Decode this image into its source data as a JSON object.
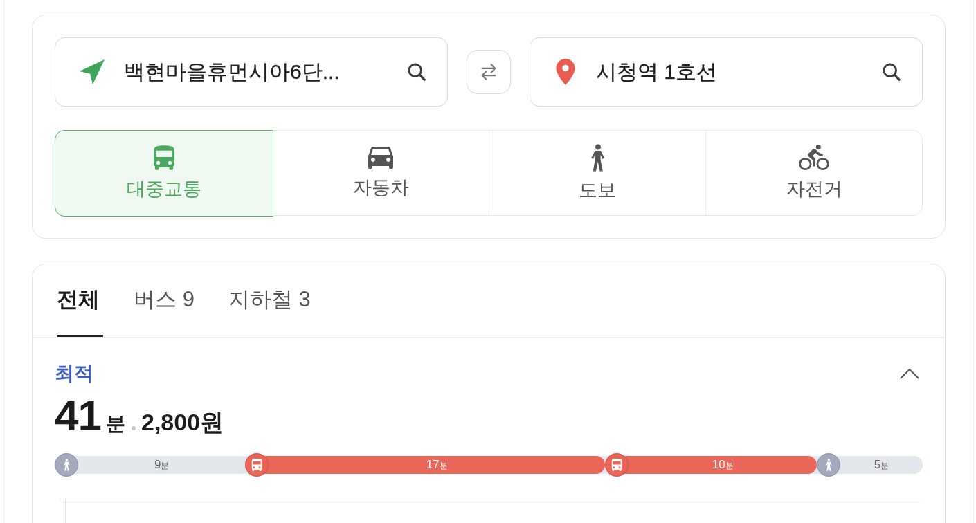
{
  "search": {
    "origin": {
      "value": "백현마을휴먼시아6단..."
    },
    "destination": {
      "value": "시청역 1호선"
    },
    "modes": [
      {
        "kind": "bus",
        "label": "대중교통",
        "selected": true
      },
      {
        "kind": "car",
        "label": "자동차",
        "selected": false
      },
      {
        "kind": "walk",
        "label": "도보",
        "selected": false
      },
      {
        "kind": "bike",
        "label": "자전거",
        "selected": false
      }
    ]
  },
  "results": {
    "tabs": [
      {
        "label": "전체",
        "selected": true
      },
      {
        "label": "버스",
        "count": "9",
        "selected": false
      },
      {
        "label": "지하철",
        "count": "3",
        "selected": false
      }
    ],
    "route": {
      "tag": "최적",
      "expanded": true,
      "duration": "41",
      "duration_unit": "분",
      "fare": "2,800원",
      "segments": [
        {
          "kind": "walk",
          "minutes": "9",
          "unit": "분"
        },
        {
          "kind": "bus",
          "minutes": "17",
          "unit": "분"
        },
        {
          "kind": "bus",
          "minutes": "10",
          "unit": "분"
        },
        {
          "kind": "walk",
          "minutes": "5",
          "unit": "분"
        }
      ]
    }
  }
}
